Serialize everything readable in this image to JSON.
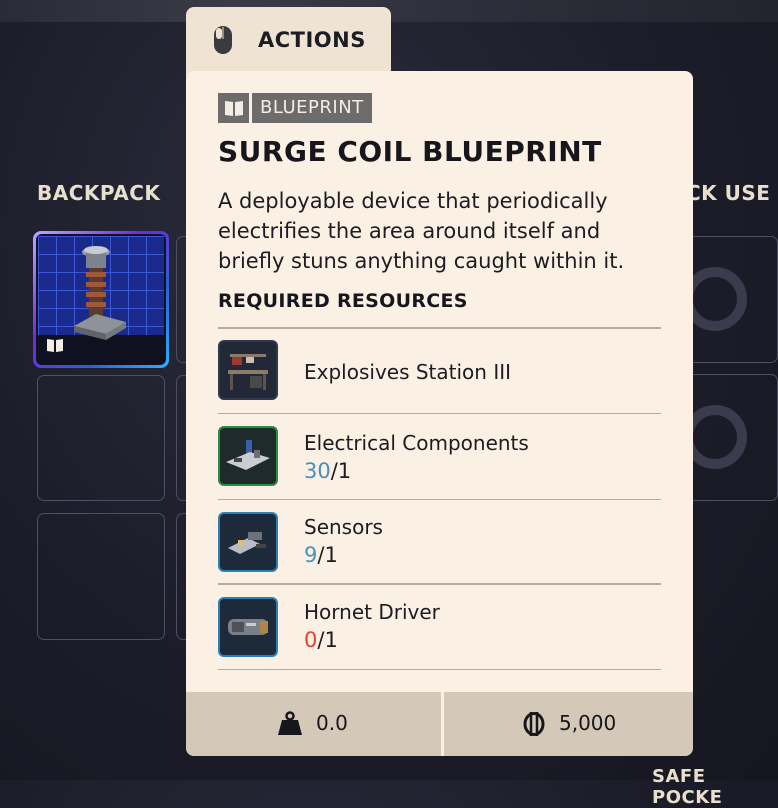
{
  "backpack": {
    "title": "BACKPACK",
    "selected_item_icon": "surge-coil-blueprint",
    "selected_item_badge": "book-icon"
  },
  "quick_use": {
    "title_fragment": "CK USE"
  },
  "safe_pocket": {
    "title_fragment": "SAFE POCKE"
  },
  "actions_tab": {
    "icon": "mouse-icon",
    "label": "ACTIONS"
  },
  "tooltip": {
    "tag_icon": "book-icon",
    "tag_label": "BLUEPRINT",
    "title": "SURGE COIL BLUEPRINT",
    "description": "A deployable device that periodically electrifies the area around itself and briefly stuns anything caught within it.",
    "required_title": "REQUIRED RESOURCES",
    "resources": [
      {
        "name": "Explosives Station III",
        "icon": "workbench-icon"
      },
      {
        "name": "Electrical Components",
        "have": "30",
        "need": "/1",
        "status_color": "#4b90b8"
      },
      {
        "name": "Sensors",
        "have": "9",
        "need": "/1",
        "status_color": "#4b90b8"
      },
      {
        "name": "Hornet Driver",
        "have": "0",
        "need": "/1",
        "status_color": "#e8402e"
      }
    ],
    "footer": {
      "weight_icon": "weight-icon",
      "weight": "0.0",
      "value_icon": "coin-icon",
      "value": "5,000"
    }
  },
  "colors": {
    "accent": "#efe4d3",
    "tooltip_bg": "#faf0e4",
    "have_ok": "#4b90b8",
    "have_missing": "#e8402e"
  }
}
